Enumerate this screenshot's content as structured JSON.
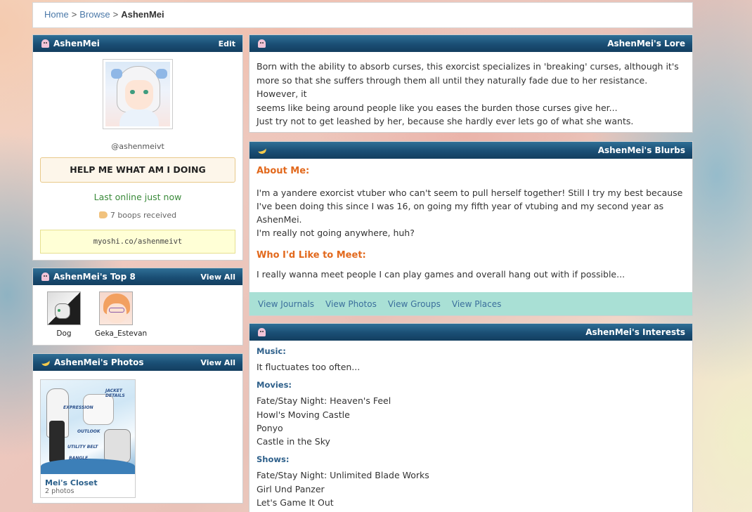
{
  "breadcrumb": {
    "home": "Home",
    "browse": "Browse",
    "sep": ">",
    "current": "AshenMei"
  },
  "profile": {
    "title": "AshenMei",
    "edit_label": "Edit",
    "handle": "@ashenmeivt",
    "status": "HELP ME WHAT AM I DOING",
    "last_online": "Last online just now",
    "boops": "7 boops received",
    "url": "myoshi.co/ashenmeivt"
  },
  "top8": {
    "title": "AshenMei's Top 8",
    "view_all": "View All",
    "friends": [
      {
        "name": "Dog"
      },
      {
        "name": "Geka_Estevan"
      }
    ]
  },
  "photos": {
    "title": "AshenMei's Photos",
    "view_all": "View All",
    "albums": [
      {
        "name": "Mei's Closet",
        "count": "2 photos"
      }
    ],
    "thumb_labels": [
      "JACKET DETAILS",
      "EXPRESSION",
      "OUTLOOK",
      "UTILITY BELT",
      "BANGLE"
    ]
  },
  "lore": {
    "title": "AshenMei's Lore",
    "line1": "Born with the ability to absorb curses, this exorcist specializes in 'breaking' curses, although it's",
    "line2": "more so that she suffers through them all until they naturally fade due to her resistance. However, it",
    "line3": "seems like being around people like you eases the burden those curses give her...",
    "line4": "Just try not to get leashed by her, because she hardly ever lets go of what she wants."
  },
  "blurbs": {
    "title": "AshenMei's Blurbs",
    "about_heading": "About Me:",
    "about_lines": [
      "I'm a yandere exorcist vtuber who can't seem to pull herself together! Still I try my best because",
      "I've been doing this since I was 16, on going my fifth year of vtubing and my second year as",
      "AshenMei.",
      "I'm really not going anywhere, huh?"
    ],
    "meet_heading": "Who I'd Like to Meet:",
    "meet_text": "I really wanna meet people I can play games and overall hang out with if possible...",
    "links": [
      "View Journals",
      "View Photos",
      "View Groups",
      "View Places"
    ]
  },
  "interests": {
    "title": "AshenMei's Interests",
    "music_label": "Music:",
    "music": [
      "It fluctuates too often..."
    ],
    "movies_label": "Movies:",
    "movies": [
      "Fate/Stay Night: Heaven's Feel",
      "Howl's Moving Castle",
      "Ponyo",
      "Castle in the Sky"
    ],
    "shows_label": "Shows:",
    "shows": [
      "Fate/Stay Night: Unlimited Blade Works",
      "Girl Und Panzer",
      "Let's Game It Out"
    ]
  }
}
